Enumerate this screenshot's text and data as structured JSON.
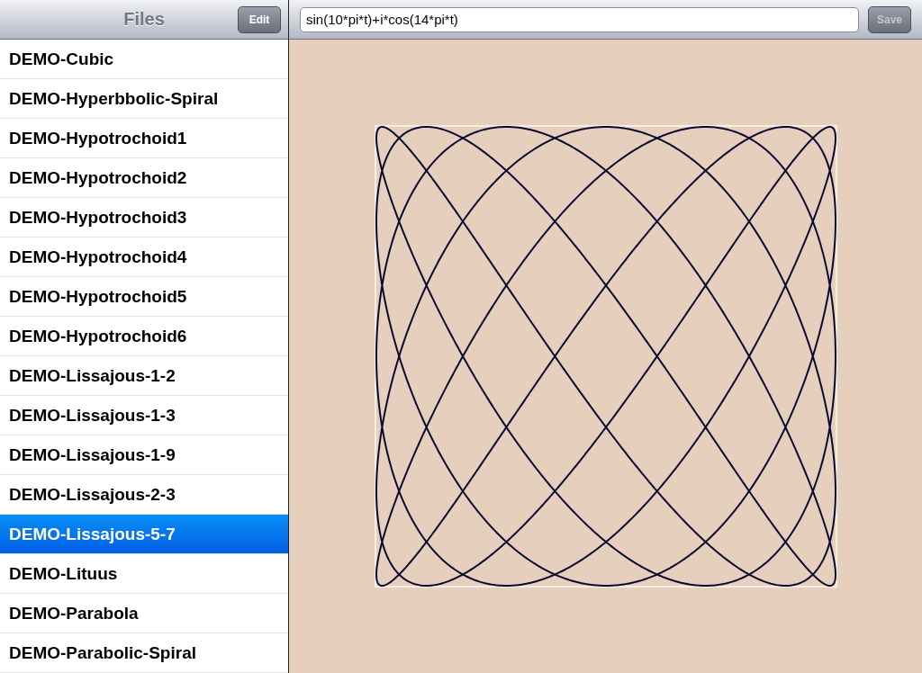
{
  "sidebar": {
    "title": "Files",
    "edit_button": "Edit",
    "items": [
      {
        "label": "DEMO-Cubic",
        "selected": false
      },
      {
        "label": "DEMO-Hyperbbolic-Spiral",
        "selected": false
      },
      {
        "label": "DEMO-Hypotrochoid1",
        "selected": false
      },
      {
        "label": "DEMO-Hypotrochoid2",
        "selected": false
      },
      {
        "label": "DEMO-Hypotrochoid3",
        "selected": false
      },
      {
        "label": "DEMO-Hypotrochoid4",
        "selected": false
      },
      {
        "label": "DEMO-Hypotrochoid5",
        "selected": false
      },
      {
        "label": "DEMO-Hypotrochoid6",
        "selected": false
      },
      {
        "label": "DEMO-Lissajous-1-2",
        "selected": false
      },
      {
        "label": "DEMO-Lissajous-1-3",
        "selected": false
      },
      {
        "label": "DEMO-Lissajous-1-9",
        "selected": false
      },
      {
        "label": "DEMO-Lissajous-2-3",
        "selected": false
      },
      {
        "label": "DEMO-Lissajous-5-7",
        "selected": true
      },
      {
        "label": "DEMO-Lituus",
        "selected": false
      },
      {
        "label": "DEMO-Parabola",
        "selected": false
      },
      {
        "label": "DEMO-Parabolic-Spiral",
        "selected": false
      }
    ]
  },
  "toolbar": {
    "expression": "sin(10*pi*t)+i*cos(14*pi*t)",
    "save_button": {
      "label": "Save",
      "disabled": true
    }
  }
}
